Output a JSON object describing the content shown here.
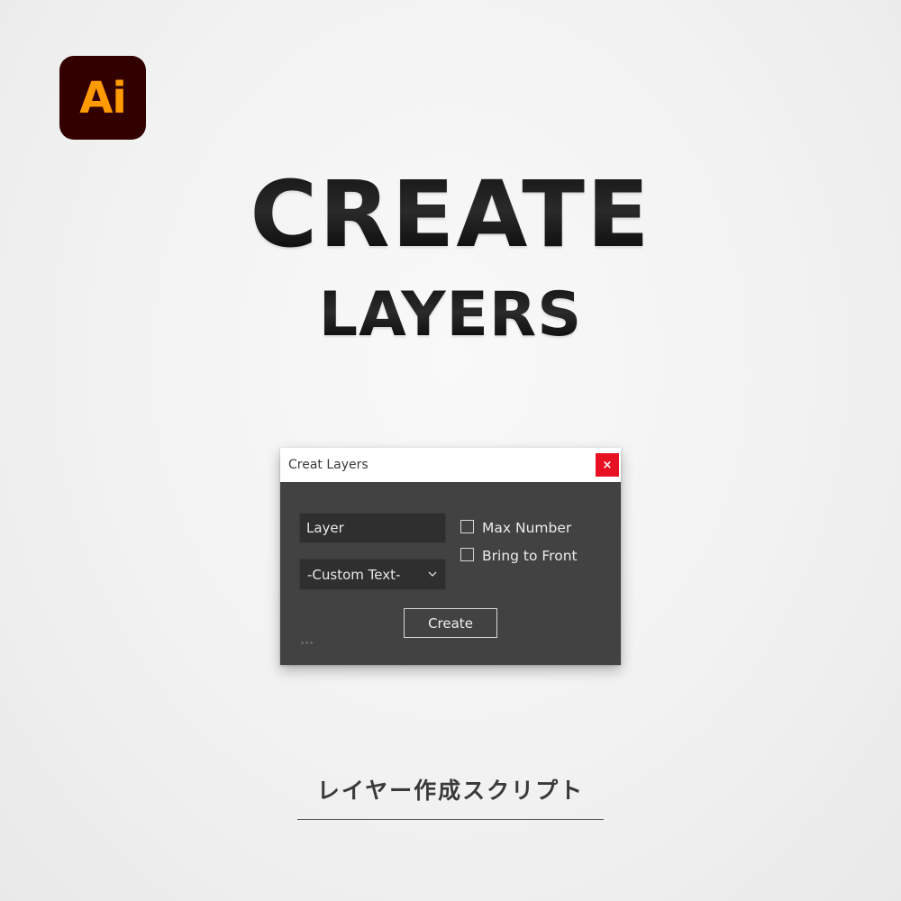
{
  "brand": {
    "logo_text": "Ai"
  },
  "headline": {
    "main": "CREATE",
    "sub": "LAYERS"
  },
  "dialog": {
    "title": "Creat Layers",
    "close_symbol": "×",
    "name_input_value": "Layer",
    "dropdown_selected": "-Custom Text-",
    "checkboxes": [
      {
        "label": "Max Number",
        "checked": false
      },
      {
        "label": "Bring to Front",
        "checked": false
      }
    ],
    "create_button_label": "Create",
    "icons": {
      "close": "close-icon",
      "dropdown": "chevron-down-icon",
      "grip": "grip-dots-icon"
    }
  },
  "caption": {
    "text": "レイヤー作成スクリプト"
  },
  "colors": {
    "logo_bg": "#330000",
    "logo_fg": "#ff9a00",
    "close_bg": "#e81123",
    "dialog_bg": "#424242",
    "input_bg": "#2f2f2f"
  }
}
